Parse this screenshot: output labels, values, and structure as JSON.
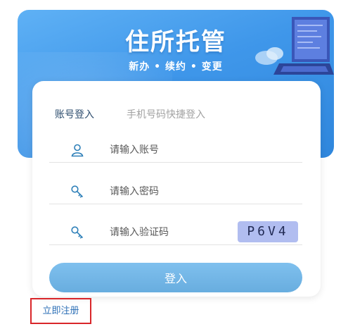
{
  "banner": {
    "title": "住所托管",
    "subtitle": "新办 • 续约 • 变更"
  },
  "tabs": {
    "account": "账号登入",
    "phone": "手机号码快捷登入"
  },
  "fields": {
    "account_placeholder": "请输入账号",
    "password_placeholder": "请输入密码",
    "captcha_placeholder": "请输入验证码"
  },
  "captcha_code": "P6V4",
  "login_label": "登入",
  "register_label": "立即注册",
  "colors": {
    "banner_blue": "#3f97ea",
    "button_blue": "#72b6e7",
    "captcha_bg": "#b1bdf0",
    "highlight_red": "#d9262a"
  }
}
